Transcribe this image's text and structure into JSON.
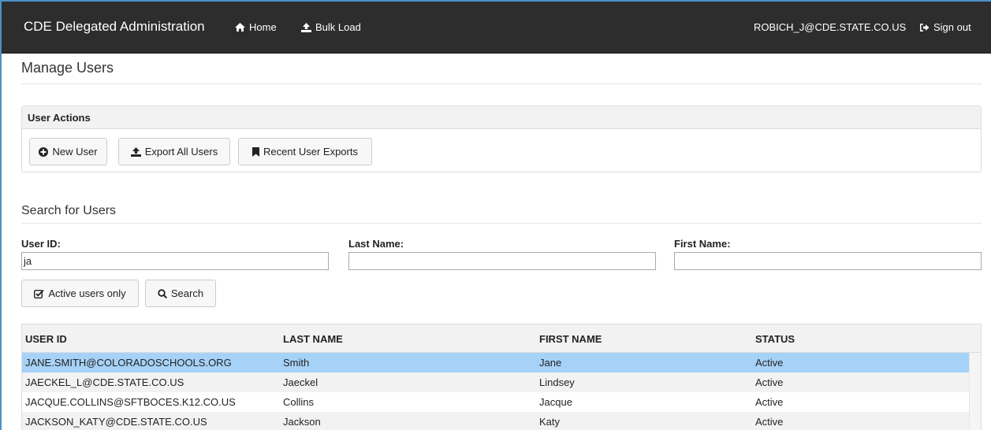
{
  "navbar": {
    "brand": "CDE Delegated Administration",
    "home_label": "Home",
    "home_icon": "home-icon",
    "bulk_label": "Bulk Load",
    "bulk_icon": "upload-icon",
    "user_email": "ROBICH_J@CDE.STATE.CO.US",
    "signout_label": "Sign out",
    "signout_icon": "sign-out-icon"
  },
  "page": {
    "title": "Manage Users"
  },
  "actions": {
    "heading": "User Actions",
    "new_user": "New User",
    "export_all": "Export All Users",
    "recent_exports": "Recent User Exports"
  },
  "search": {
    "title": "Search for Users",
    "user_id_label": "User ID:",
    "user_id_value": "ja",
    "last_name_label": "Last Name:",
    "last_name_value": "",
    "first_name_label": "First Name:",
    "first_name_value": "",
    "active_only_label": "Active users only",
    "search_label": "Search"
  },
  "table": {
    "columns": [
      "USER ID",
      "LAST NAME",
      "FIRST NAME",
      "STATUS"
    ],
    "rows": [
      [
        "JANE.SMITH@COLORADOSCHOOLS.ORG",
        "Smith",
        "Jane",
        "Active"
      ],
      [
        "JAECKEL_L@CDE.STATE.CO.US",
        "Jaeckel",
        "Lindsey",
        "Active"
      ],
      [
        "JACQUE.COLLINS@SFTBOCES.K12.CO.US",
        "Collins",
        "Jacque",
        "Active"
      ],
      [
        "JACKSON_KATY@CDE.STATE.CO.US",
        "Jackson",
        "Katy",
        "Active"
      ]
    ],
    "selected_row_color": "#a7d2f7"
  },
  "colors": {
    "navbar_bg": "#2d2d2d",
    "panel_heading_bg": "#f2f2f2",
    "accent_border": "#4a90c8"
  }
}
